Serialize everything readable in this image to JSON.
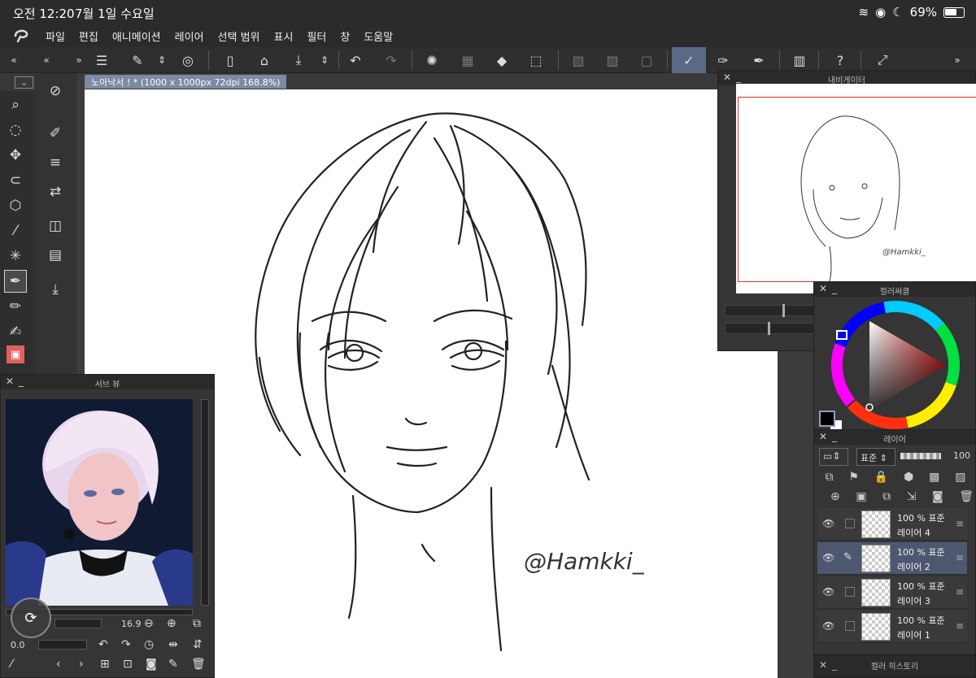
{
  "status": {
    "time": "오전 12:20",
    "date": "7월 1일 수요일",
    "battery": "69%"
  },
  "menu": [
    "파일",
    "편집",
    "애니메이션",
    "레이어",
    "선택 범위",
    "표시",
    "필터",
    "창",
    "도움말"
  ],
  "document": {
    "tab_title": "노아낙서 ! * (1000 x 1000px 72dpi 168.8%)"
  },
  "navigator": {
    "title": "내비게이터"
  },
  "color_wheel": {
    "title": "컬러써클",
    "foreground": "#000000",
    "background": "#ffffff"
  },
  "layers": {
    "title": "레이어",
    "blend_mode": "표준",
    "opacity": "100",
    "items": [
      {
        "name": "레이어 4",
        "info": "100 % 표준",
        "selected": false
      },
      {
        "name": "레이어 2",
        "info": "100 % 표준",
        "selected": true
      },
      {
        "name": "레이어 3",
        "info": "100 % 표준",
        "selected": false
      },
      {
        "name": "레이어 1",
        "info": "100 % 표준",
        "selected": false
      }
    ]
  },
  "color_history": {
    "title": "컬러 히스토리"
  },
  "subview": {
    "title": "서브 뷰",
    "zoom": "16.9",
    "rotation": "0.0"
  },
  "signature": "@Hamkki_",
  "accent": "#5b6a84"
}
